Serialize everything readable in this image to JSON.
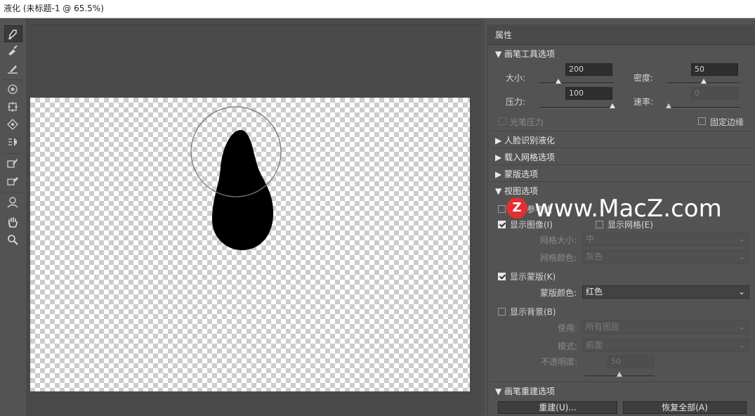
{
  "window": {
    "title": "液化 (未标题-1 @ 65.5%)"
  },
  "toolbar": {
    "tools": [
      "forward-warp-icon",
      "reconstruct-icon",
      "smooth-icon",
      "twirl-icon",
      "pucker-icon",
      "bloat-icon",
      "push-left-icon",
      "freeze-mask-icon",
      "thaw-mask-icon",
      "face-tool-icon",
      "hand-icon",
      "zoom-icon"
    ]
  },
  "panel": {
    "title": "属性",
    "brush_options": {
      "header": "▼ 画笔工具选项",
      "size_label": "大小:",
      "size_value": "200",
      "density_label": "密度:",
      "density_value": "50",
      "pressure_label": "压力:",
      "pressure_value": "100",
      "rate_label": "速率:",
      "rate_value": "0",
      "stylus_label": "光笔压力",
      "pin_edges_label": "固定边缘"
    },
    "face_aware": {
      "header": "▶ 人脸识别液化"
    },
    "load_mesh": {
      "header": "▶ 载入网格选项"
    },
    "mask_options": {
      "header": "▶ 蒙版选项"
    },
    "view_options": {
      "header": "▼ 视图选项",
      "guides_label": "显示参考线",
      "show_image_label": "显示图像(I)",
      "show_mesh_label": "显示网格(E)",
      "mesh_size_label": "网格大小:",
      "mesh_size_value": "中",
      "mesh_color_label": "网格颜色:",
      "mesh_color_value": "灰色",
      "show_mask_label": "显示蒙版(K)",
      "mask_color_label": "蒙版颜色:",
      "mask_color_value": "红色",
      "show_backdrop_label": "显示背景(B)",
      "use_label": "使用:",
      "use_value": "所有图层",
      "mode_label": "模式:",
      "mode_value": "前面",
      "opacity_label": "不透明度:",
      "opacity_value": "50"
    },
    "reconstruct": {
      "header": "▼ 画笔重建选项",
      "reconstruct_button": "重建(U)...",
      "restore_all_button": "恢复全部(A)"
    }
  },
  "watermark": {
    "logo": "Z",
    "text": "www.MacZ.com"
  },
  "chevron": "⌄"
}
